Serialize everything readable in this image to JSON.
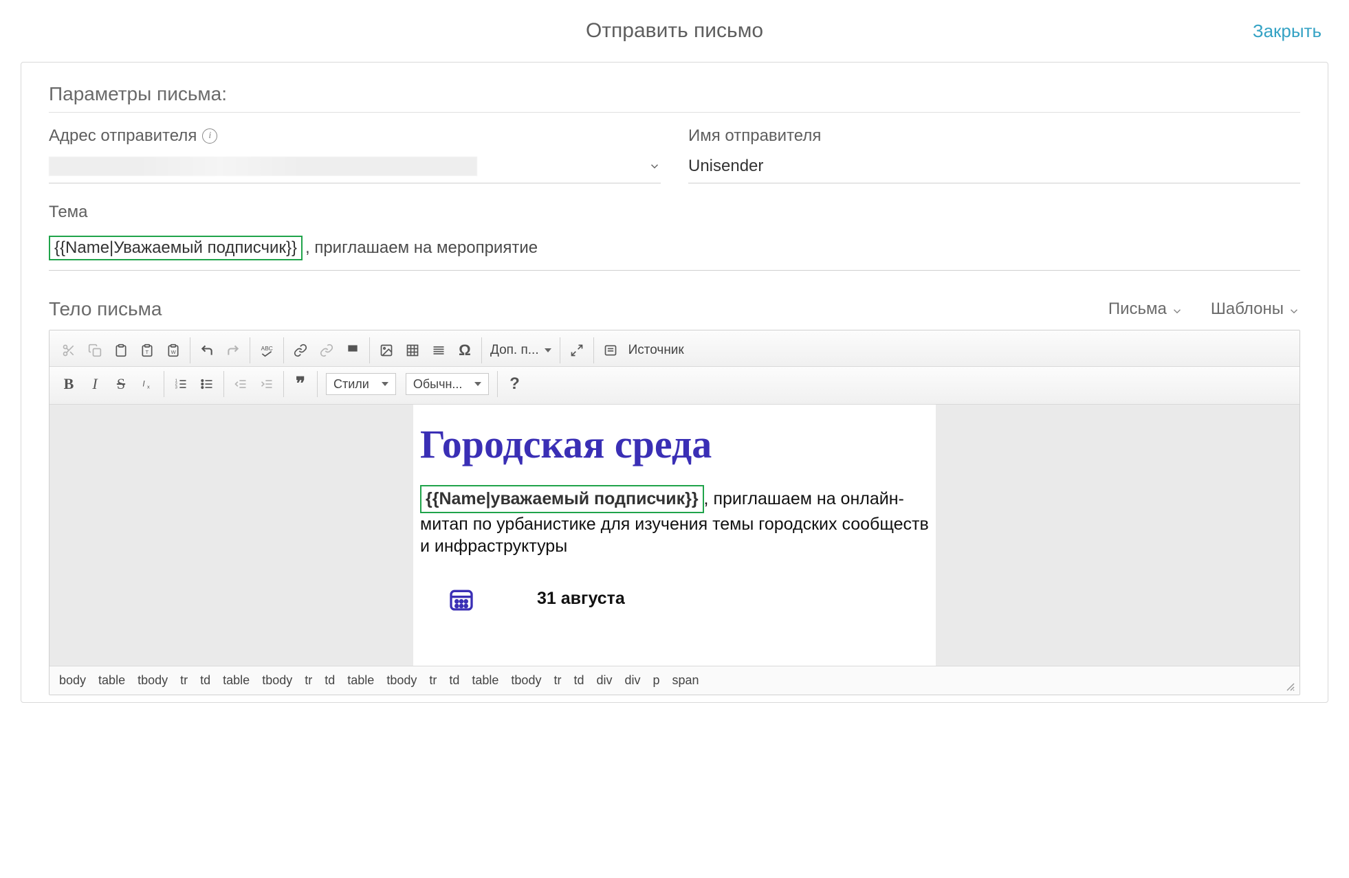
{
  "header": {
    "title": "Отправить письмо",
    "close": "Закрыть"
  },
  "params": {
    "section_label": "Параметры письма:",
    "sender_address_label": "Адрес отправителя",
    "sender_name_label": "Имя отправителя",
    "sender_name_value": "Unisender",
    "subject_label": "Тема",
    "subject_token": "{{Name|Уважаемый подписчик}}",
    "subject_rest": ", приглашаем на мероприятие"
  },
  "body_section": {
    "label": "Тело письма",
    "letters_dropdown": "Письма",
    "templates_dropdown": "Шаблоны"
  },
  "toolbar": {
    "extra_label": "Доп. п...",
    "source_label": "Источник",
    "styles_label": "Стили",
    "format_label": "Обычн..."
  },
  "email": {
    "title": "Городская среда",
    "para_token": "{{Name|уважаемый подписчик}}",
    "para_rest": ", приглашаем на онлайн-митап по урбанистике для изучения темы городских сообществ и инфраструктуры",
    "date": "31 августа"
  },
  "path": [
    "body",
    "table",
    "tbody",
    "tr",
    "td",
    "table",
    "tbody",
    "tr",
    "td",
    "table",
    "tbody",
    "tr",
    "td",
    "table",
    "tbody",
    "tr",
    "td",
    "div",
    "div",
    "p",
    "span"
  ]
}
